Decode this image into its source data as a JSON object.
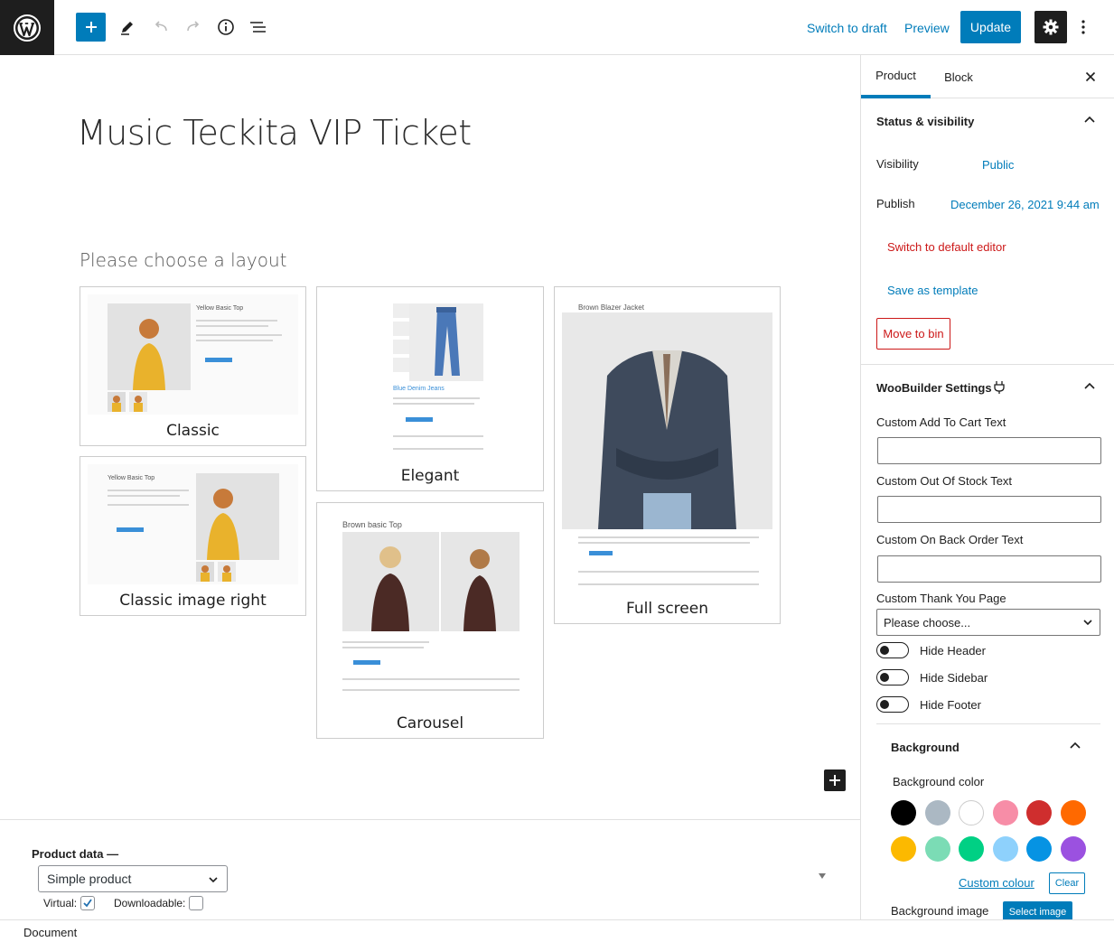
{
  "toolbar": {
    "switch_to_draft": "Switch to draft",
    "preview": "Preview",
    "update": "Update"
  },
  "editor": {
    "post_title": "Music Teckita VIP Ticket",
    "layout_heading": "Please choose a layout",
    "layouts": [
      {
        "label": "Classic",
        "thumb_title": "Yellow Basic Top"
      },
      {
        "label": "Elegant",
        "thumb_title": "Blue Denim Jeans"
      },
      {
        "label": "Full screen",
        "thumb_title": "Brown Blazer Jacket"
      },
      {
        "label": "Classic image right",
        "thumb_title": "Yellow Basic Top"
      },
      {
        "label": "Carousel",
        "thumb_title": "Brown basic Top"
      }
    ]
  },
  "product_data": {
    "label": "Product data —",
    "type": "Simple product",
    "virtual_label": "Virtual:",
    "virtual_checked": true,
    "downloadable_label": "Downloadable:",
    "downloadable_checked": false
  },
  "footer": {
    "breadcrumb": "Document"
  },
  "sidebar": {
    "tabs": [
      "Product",
      "Block"
    ],
    "active_tab": "Product",
    "status_panel": {
      "title": "Status & visibility",
      "visibility_label": "Visibility",
      "visibility_value": "Public",
      "publish_label": "Publish",
      "publish_value": "December 26, 2021 9:44 am",
      "switch_editor": "Switch to default editor",
      "save_template": "Save as template",
      "move_to_bin": "Move to bin"
    },
    "woobuilder": {
      "title": "WooBuilder Settings",
      "add_to_cart_label": "Custom Add To Cart Text",
      "add_to_cart_value": "",
      "out_of_stock_label": "Custom Out Of Stock Text",
      "out_of_stock_value": "",
      "back_order_label": "Custom On Back Order Text",
      "back_order_value": "",
      "thank_you_label": "Custom Thank You Page",
      "thank_you_value": "Please choose...",
      "toggles": [
        {
          "label": "Hide Header",
          "checked": false
        },
        {
          "label": "Hide Sidebar",
          "checked": false
        },
        {
          "label": "Hide Footer",
          "checked": false
        }
      ]
    },
    "background": {
      "title": "Background",
      "color_label": "Background color",
      "colors": [
        "#000000",
        "#abb8c3",
        "#ffffff",
        "#f78da7",
        "#cf2e2e",
        "#ff6900",
        "#fcb900",
        "#7bdcb5",
        "#00d084",
        "#8ed1fc",
        "#0693e3",
        "#9b51e0"
      ],
      "custom_colour": "Custom colour",
      "clear": "Clear",
      "image_label": "Background image",
      "select_image": "Select image"
    }
  }
}
